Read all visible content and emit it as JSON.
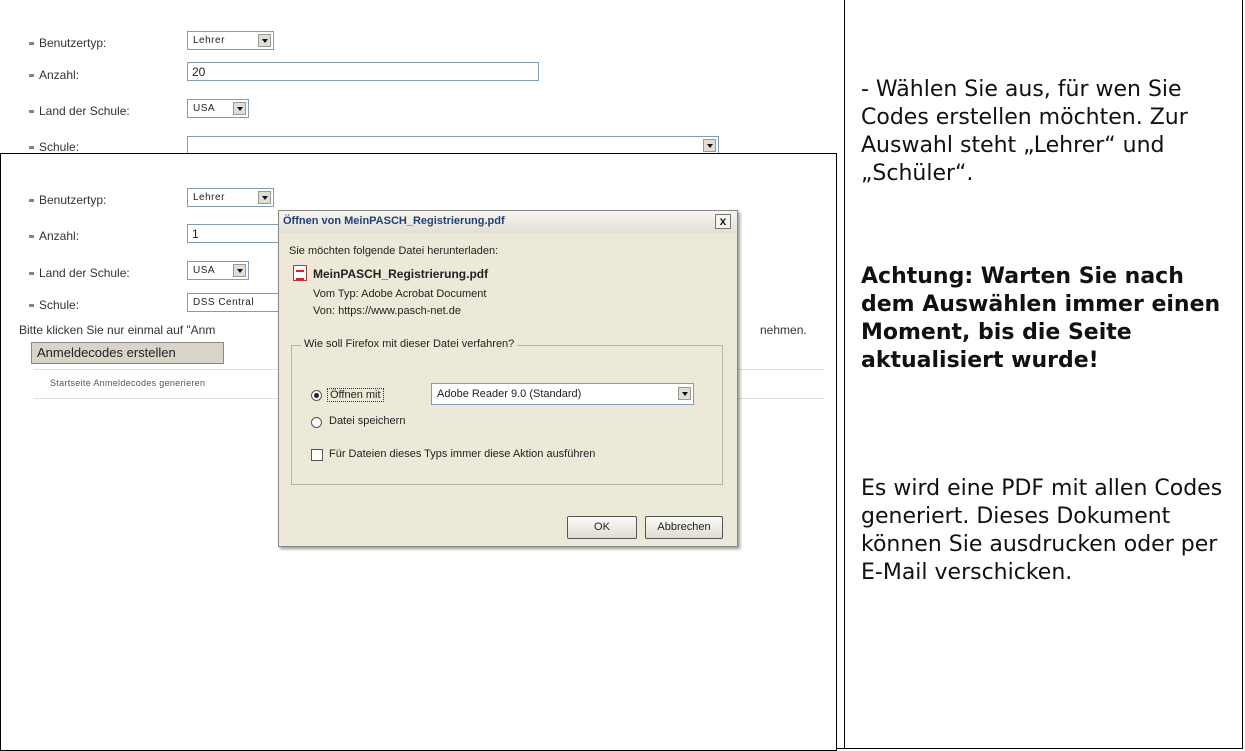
{
  "form_top": {
    "user_type_label": "Benutzertyp:",
    "user_type_value": "Lehrer",
    "count_label": "Anzahl:",
    "count_value": "20",
    "country_label": "Land der Schule:",
    "country_value": "USA",
    "school_label": "Schule:",
    "school_value": ""
  },
  "form_second": {
    "user_type_label": "Benutzertyp:",
    "user_type_value": "Lehrer",
    "count_label": "Anzahl:",
    "count_value": "1",
    "country_label": "Land der Schule:",
    "country_value": "USA",
    "school_label": "Schule:",
    "school_value": "DSS Central",
    "hint_text_left": "Bitte klicken Sie nur einmal auf \"Anm",
    "hint_text_right": "nehmen.",
    "submit_label": "Anmeldecodes erstellen",
    "footer_text": "Startseite   Anmeldecodes generieren"
  },
  "dialog": {
    "title": "Öffnen von MeinPASCH_Registrierung.pdf",
    "intro": "Sie möchten folgende Datei herunterladen:",
    "filename": "MeinPASCH_Registrierung.pdf",
    "type_line": "Vom Typ:  Adobe Acrobat Document",
    "from_line": "Von:  https://www.pasch-net.de",
    "group_label": "Wie soll Firefox mit dieser Datei verfahren?",
    "open_with_label": "Öffnen mit",
    "open_with_value": "Adobe Reader 9.0 (Standard)",
    "save_label": "Datei speichern",
    "always_label": "Für Dateien dieses Typs immer diese Aktion ausführen",
    "ok_label": "OK",
    "cancel_label": "Abbrechen",
    "close_glyph": "x"
  },
  "instructions": {
    "para1": "- Wählen Sie aus, für wen Sie Codes erstellen möchten. Zur Auswahl steht „Lehrer“ und „Schüler“.",
    "para2": "Achtung: Warten Sie nach dem Auswählen immer einen Moment, bis die Seite aktualisiert wurde!",
    "para3": "Es wird eine PDF mit allen Codes generiert. Dieses Dokument können Sie ausdrucken oder per E-Mail verschicken."
  },
  "colors": {
    "bullet": "#6a9a5a",
    "dialog_bg": "#ece9d8",
    "title_text": "#1f3f7a"
  }
}
